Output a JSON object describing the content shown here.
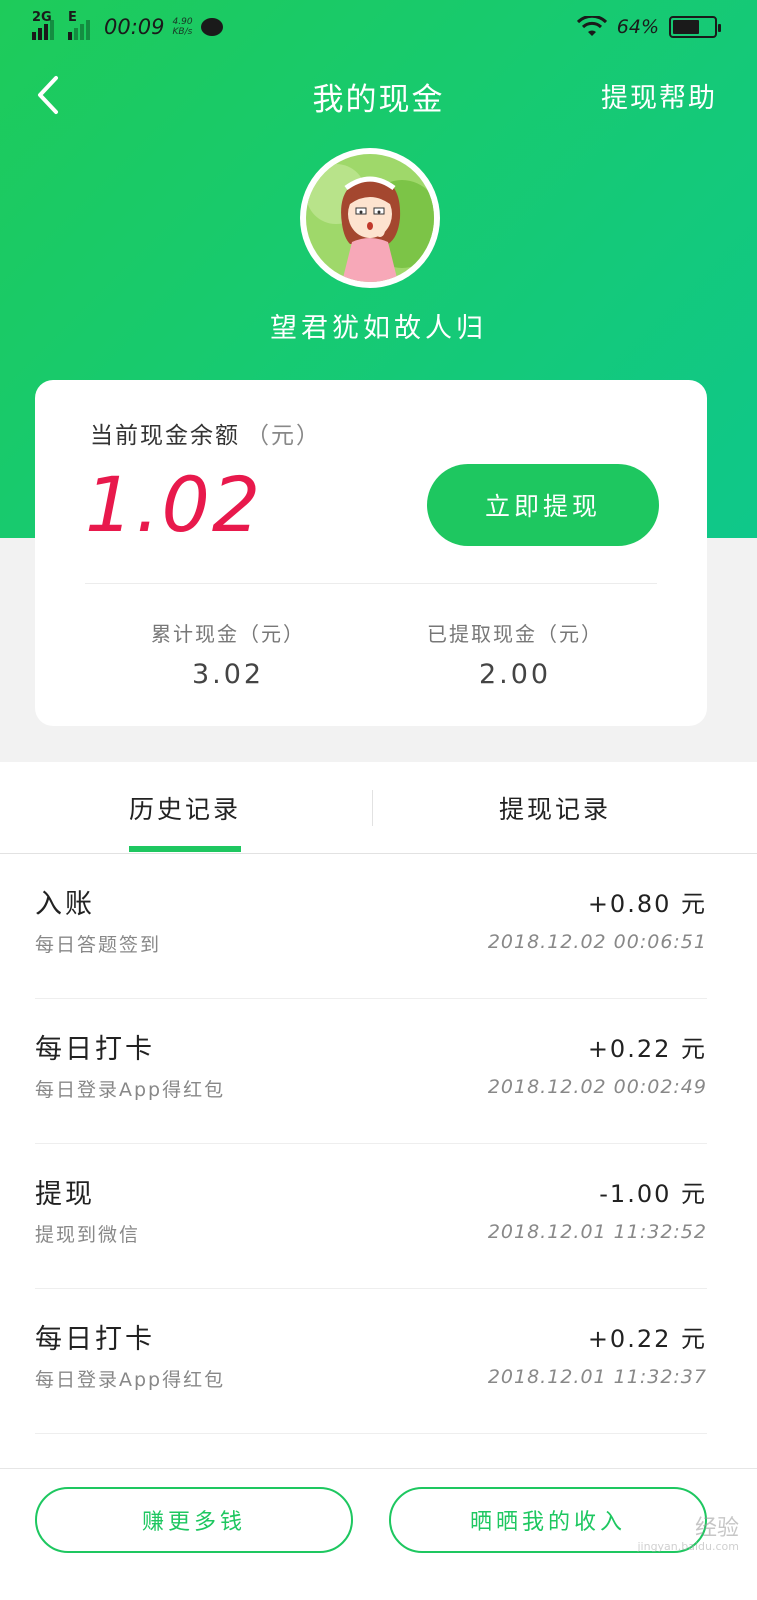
{
  "status_bar": {
    "network_1": "2G",
    "network_2": "E",
    "time": "00:09",
    "speed_value": "4.90",
    "speed_unit": "KB/s",
    "battery": "64%",
    "battery_level": 0.64
  },
  "nav": {
    "title": "我的现金",
    "help": "提现帮助"
  },
  "profile": {
    "username": "望君犹如故人归"
  },
  "balance_card": {
    "label": "当前现金余额",
    "unit": "（元）",
    "balance": "1.02",
    "withdraw_button": "立即提现",
    "stats": [
      {
        "label": "累计现金（元）",
        "value": "3.02"
      },
      {
        "label": "已提取现金（元）",
        "value": "2.00"
      }
    ]
  },
  "tabs": [
    {
      "label": "历史记录",
      "active": true
    },
    {
      "label": "提现记录",
      "active": false
    }
  ],
  "records": [
    {
      "title": "入账",
      "subtitle": "每日答题签到",
      "amount": "+0.80 元",
      "time": "2018.12.02 00:06:51"
    },
    {
      "title": "每日打卡",
      "subtitle": "每日登录App得红包",
      "amount": "+0.22 元",
      "time": "2018.12.02 00:02:49"
    },
    {
      "title": "提现",
      "subtitle": "提现到微信",
      "amount": "-1.00 元",
      "time": "2018.12.01 11:32:52"
    },
    {
      "title": "每日打卡",
      "subtitle": "每日登录App得红包",
      "amount": "+0.22 元",
      "time": "2018.12.01 11:32:37"
    }
  ],
  "bottom": {
    "earn_more": "赚更多钱",
    "share_income": "晒晒我的收入",
    "watermark": "经验",
    "watermark_sub": "jingyan.baidu.com"
  },
  "colors": {
    "brand_green": "#1ec760",
    "balance_red": "#e8194c"
  }
}
